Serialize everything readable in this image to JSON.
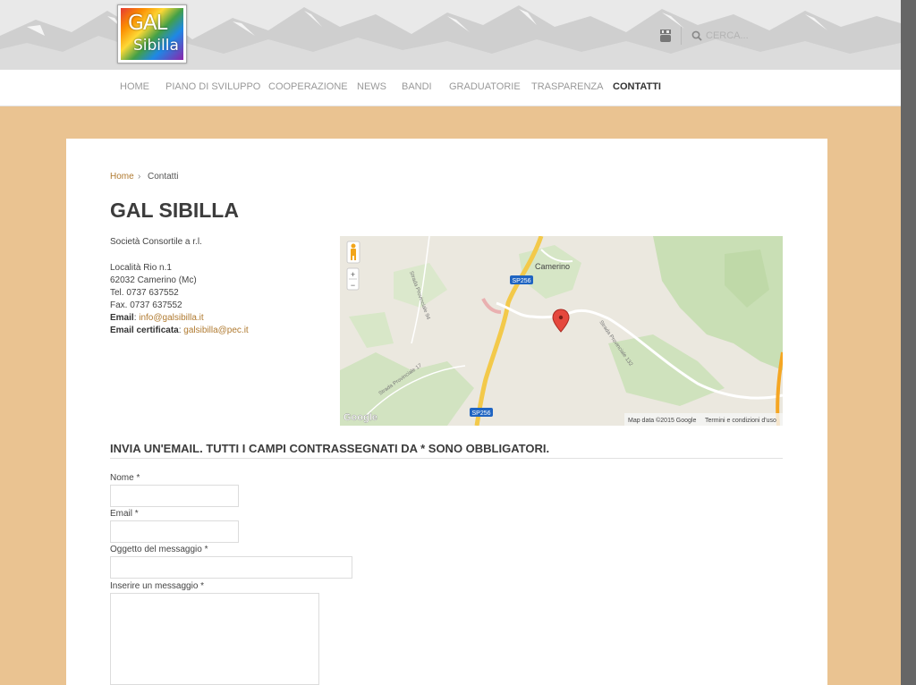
{
  "header": {
    "logo": {
      "line1": "GAL",
      "line2": "Sibilla"
    },
    "social": {
      "youtube_icon": "youtube-icon"
    },
    "search": {
      "placeholder": "CERCA...",
      "icon": "search-icon"
    }
  },
  "nav": {
    "items": [
      {
        "label": "HOME"
      },
      {
        "label": "PIANO DI SVILUPPO"
      },
      {
        "label": "COOPERAZIONE"
      },
      {
        "label": "NEWS"
      },
      {
        "label": "BANDI"
      },
      {
        "label": "GRADUATORIE"
      },
      {
        "label": "TRASPARENZA"
      },
      {
        "label": "CONTATTI",
        "active": true
      }
    ]
  },
  "breadcrumb": {
    "home": "Home",
    "separator": "›",
    "current": "Contatti"
  },
  "page": {
    "title": "GAL SIBILLA"
  },
  "contact": {
    "company": "Società Consortile a r.l.",
    "address1": "Località Rio n.1",
    "address2": "62032 Camerino (Mc)",
    "tel": "Tel. 0737 637552",
    "fax": "Fax. 0737 637552",
    "email_label": "Email",
    "email": "info@galsibilla.it",
    "pec_label": "Email certificata",
    "pec": "galsibilla@pec.it"
  },
  "map": {
    "town": "Camerino",
    "road_badge_1": "SP256",
    "road_badge_2": "SP256",
    "road_label_1": "Strada Provinciale 94",
    "road_label_2": "Strada Provinciale 17",
    "road_label_3": "Strada Provinciale 132",
    "zoom_in": "+",
    "zoom_out": "−",
    "attribution": "Map data ©2015 Google",
    "terms": "Termini e condizioni d'uso",
    "google_logo": "Google"
  },
  "form": {
    "heading": "INVIA UN'EMAIL. TUTTI I CAMPI CONTRASSEGNATI DA * SONO OBBLIGATORI.",
    "name_label": "Nome *",
    "email_label": "Email *",
    "subject_label": "Oggetto del messaggio *",
    "message_label": "Inserire un messaggio *"
  },
  "colors": {
    "page_bg": "#eac391",
    "link": "#b07a30",
    "nav_active": "#333333",
    "nav_inactive": "#999999"
  }
}
